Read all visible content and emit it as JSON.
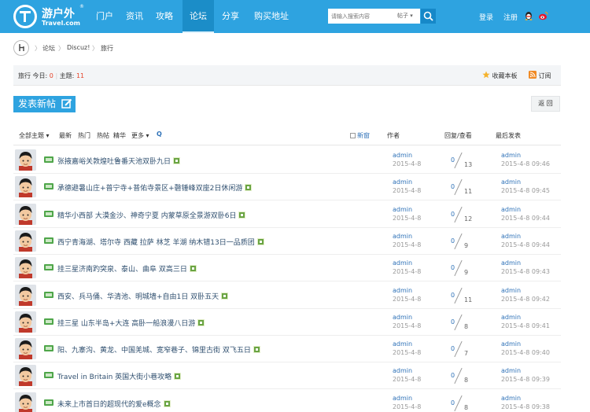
{
  "header": {
    "logo_text": "游户外",
    "logo_reg": "®",
    "logo_domain": "Travel.com",
    "nav": [
      {
        "label": "门户",
        "active": false
      },
      {
        "label": "资讯",
        "active": false
      },
      {
        "label": "攻略",
        "active": false
      },
      {
        "label": "论坛",
        "active": true
      },
      {
        "label": "分享",
        "active": false
      },
      {
        "label": "购买地址",
        "active": false
      }
    ],
    "search_placeholder": "请输入搜索内容",
    "search_category": "帖子 ▾",
    "login": "登录",
    "register": "注册",
    "accent_color": "#2ea3e0"
  },
  "breadcrumb": [
    "论坛",
    "Discuz!",
    "旅行"
  ],
  "forum": {
    "name": "旅行",
    "today_label": "今日:",
    "today_count": "0",
    "topics_label": "主题:",
    "topics_count": "11",
    "favorite": "收藏本板",
    "subscribe": "订阅"
  },
  "actions": {
    "new_post": "发表新帖",
    "back": "返 回"
  },
  "filters": {
    "all": "全部主题 ▾",
    "latest": "最新",
    "hot": "热门",
    "hottest": "热帖",
    "digest": "精华",
    "more": "更多 ▾",
    "q": "Q",
    "new_label": "新窗"
  },
  "columns": {
    "author": "作者",
    "reply_view": "回复/查看",
    "last_post": "最后发表"
  },
  "threads": [
    {
      "title": "张掖嘉峪关敦煌吐鲁番天池双卧九日",
      "author": "admin",
      "date": "2015-4-8",
      "replies": "0",
      "views": "13",
      "last_author": "admin",
      "last_time": "2015-4-8 09:46"
    },
    {
      "title": "承德避暑山庄+普宁寺+普佑寺景区+磬锤峰双座2日休闲游",
      "author": "admin",
      "date": "2015-4-8",
      "replies": "0",
      "views": "11",
      "last_author": "admin",
      "last_time": "2015-4-8 09:45"
    },
    {
      "title": "精华小西部 大漠金沙、神奇宁夏 内蒙草原全景游双卧6日",
      "author": "admin",
      "date": "2015-4-8",
      "replies": "0",
      "views": "12",
      "last_author": "admin",
      "last_time": "2015-4-8 09:44"
    },
    {
      "title": "西宁青海湖、塔尔寺 西藏 拉萨 林芝 羊湖 纳木错13日一品质团",
      "author": "admin",
      "date": "2015-4-8",
      "replies": "0",
      "views": "9",
      "last_author": "admin",
      "last_time": "2015-4-8 09:44"
    },
    {
      "title": "挂三星济南趵突泉、泰山、曲阜 双高三日",
      "author": "admin",
      "date": "2015-4-8",
      "replies": "0",
      "views": "9",
      "last_author": "admin",
      "last_time": "2015-4-8 09:43"
    },
    {
      "title": "西安、兵马俑、华清池、明城墙+自由1日 双卧五天",
      "author": "admin",
      "date": "2015-4-8",
      "replies": "0",
      "views": "11",
      "last_author": "admin",
      "last_time": "2015-4-8 09:42"
    },
    {
      "title": "挂三星 山东半岛+大连 高卧一船浪漫八日游",
      "author": "admin",
      "date": "2015-4-8",
      "replies": "0",
      "views": "8",
      "last_author": "admin",
      "last_time": "2015-4-8 09:41"
    },
    {
      "title": "阳、九寨沟、黄龙、中国羌城、宽窄巷子、锦里古街 双飞五日",
      "author": "admin",
      "date": "2015-4-8",
      "replies": "0",
      "views": "7",
      "last_author": "admin",
      "last_time": "2015-4-8 09:40"
    },
    {
      "title": "Travel in Britain 英国大街小巷攻略",
      "author": "admin",
      "date": "2015-4-8",
      "replies": "0",
      "views": "8",
      "last_author": "admin",
      "last_time": "2015-4-8 09:39"
    },
    {
      "title": "未来上市首日的超现代的爱e概念",
      "author": "admin",
      "date": "2015-4-8",
      "replies": "0",
      "views": "8",
      "last_author": "admin",
      "last_time": "2015-4-8 09:38"
    }
  ]
}
